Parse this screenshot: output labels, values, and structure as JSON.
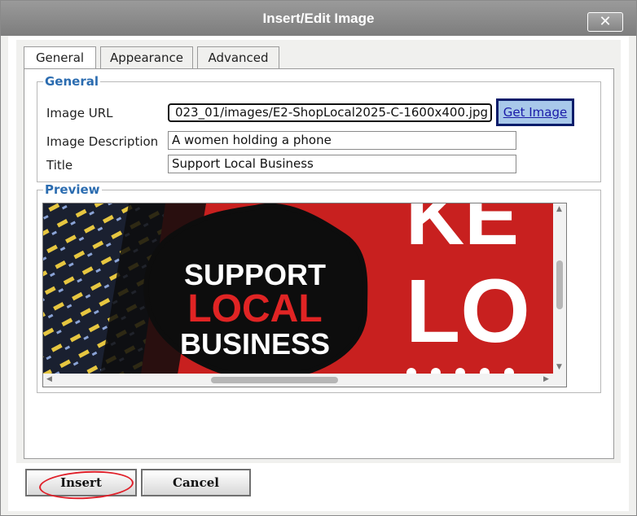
{
  "dialog": {
    "title": "Insert/Edit Image",
    "close_glyph": "✕",
    "close_icon": "close-icon"
  },
  "tabs": [
    {
      "label": "General",
      "active": true
    },
    {
      "label": "Appearance",
      "active": false
    },
    {
      "label": "Advanced",
      "active": false
    }
  ],
  "general": {
    "legend": "General",
    "image_url_label": "Image URL",
    "image_url_value": "023_01/images/E2-ShopLocal2025-C-1600x400.jpg",
    "get_image_label": "Get Image",
    "description_label": "Image Description",
    "description_value": "A women holding a phone",
    "title_label": "Title",
    "title_value": "Support Local Business"
  },
  "preview": {
    "legend": "Preview",
    "badge_line1": "SUPPORT",
    "badge_line2": "LOCAL",
    "badge_line3": "BUSINESS",
    "bg_text_line1": "KE",
    "bg_text_line2": "LO",
    "colors": {
      "red": "#c8201f",
      "black": "#0d0d0d",
      "white": "#ffffff"
    }
  },
  "buttons": {
    "insert_label": "Insert",
    "cancel_label": "Cancel"
  },
  "annotation": {
    "color": "#e0202a",
    "target": "insert-button"
  },
  "colors": {
    "titlebar": "#8a8a8a",
    "legend": "#2b6cb0",
    "link": "#1a1aa8",
    "get_image_bg": "#a8c8ea"
  }
}
